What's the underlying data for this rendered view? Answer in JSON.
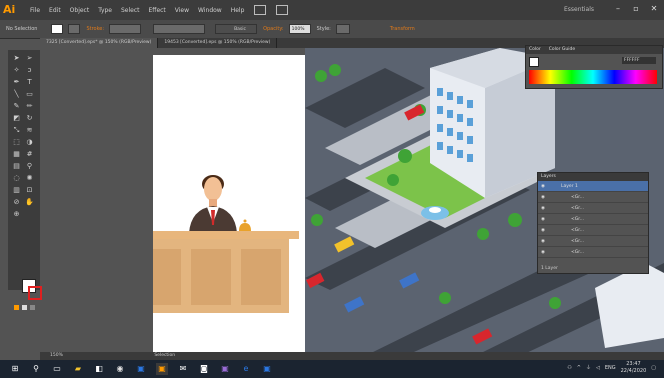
{
  "app": {
    "logo": "Ai"
  },
  "menubar": {
    "items": [
      "File",
      "Edit",
      "Object",
      "Type",
      "Select",
      "Effect",
      "View",
      "Window",
      "Help"
    ],
    "workspace": "Essentials"
  },
  "controlbar": {
    "selection_label": "No Selection",
    "stroke_label": "Stroke:",
    "basic_label": "Basic",
    "opacity_label": "Opacity:",
    "opacity_value": "100%",
    "style_label": "Style:",
    "transform_label": "Transform"
  },
  "tabs": [
    {
      "label": "7325 [Converted].eps* @ 150% (RGB/Preview)",
      "active": true
    },
    {
      "label": "19453 [Converted].eps @ 150% (RGB/Preview)",
      "active": false
    }
  ],
  "color_panel": {
    "tabs": [
      "Color",
      "Color Guide"
    ],
    "hex": "FFFFFF"
  },
  "layers_panel": {
    "title": "Layers",
    "layers": [
      "Layer 1",
      "<Gr...",
      "<Gr...",
      "<Gr...",
      "<Gr...",
      "<Gr...",
      "<Gr..."
    ],
    "footer": "1 Layer"
  },
  "statusbar": {
    "zoom": "150%",
    "tool": "Selection"
  },
  "tray": {
    "language": "ENG",
    "time": "23:47",
    "date": "22/4/2020"
  },
  "colors": {
    "accent": "#ff9a00",
    "artboard": "#ffffff",
    "desk": "#e3b57f"
  }
}
